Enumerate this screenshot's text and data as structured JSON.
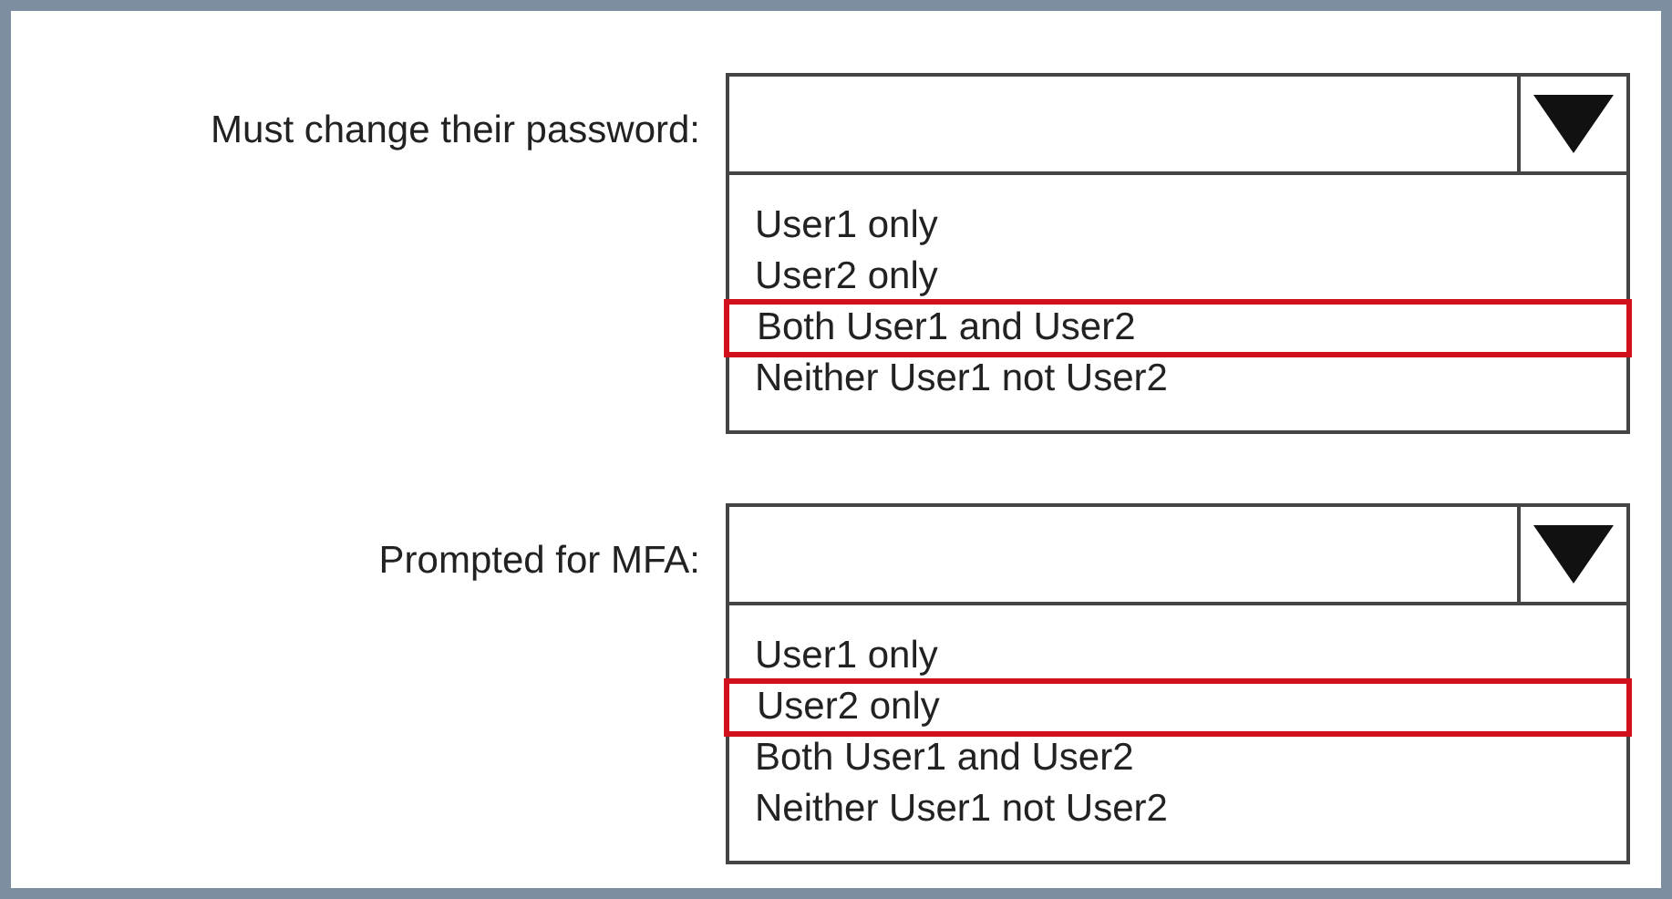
{
  "questions": [
    {
      "label": "Must change their password:",
      "options": [
        {
          "text": "User1 only",
          "selected": false
        },
        {
          "text": "User2 only",
          "selected": false
        },
        {
          "text": "Both User1 and User2",
          "selected": true
        },
        {
          "text": "Neither User1 not User2",
          "selected": false
        }
      ]
    },
    {
      "label": "Prompted for MFA:",
      "options": [
        {
          "text": "User1 only",
          "selected": false
        },
        {
          "text": "User2 only",
          "selected": true
        },
        {
          "text": "Both User1 and User2",
          "selected": false
        },
        {
          "text": "Neither User1 not User2",
          "selected": false
        }
      ]
    }
  ]
}
